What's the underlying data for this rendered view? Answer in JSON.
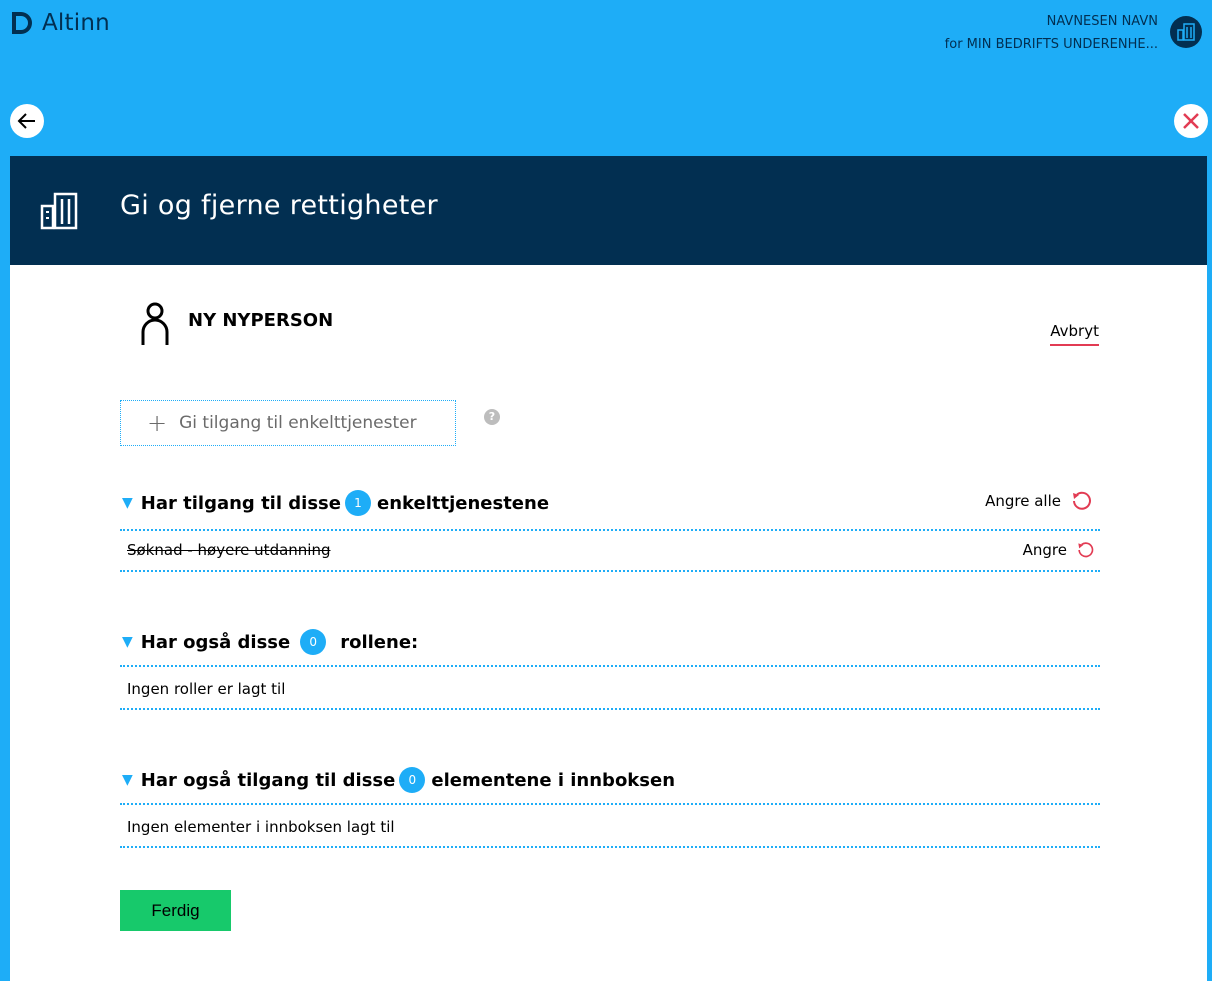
{
  "app": {
    "name": "Altinn"
  },
  "user": {
    "name": "NAVNESEN NAVN",
    "org": "for MIN BEDRIFTS UNDERENHE..."
  },
  "page": {
    "title": "Gi og fjerne rettigheter"
  },
  "person": {
    "name": "NY NYPERSON"
  },
  "actions": {
    "cancel": "Avbryt",
    "add_service": "Gi tilgang til enkelttjenester",
    "help": "?",
    "done": "Ferdig"
  },
  "sections": {
    "services": {
      "title_before": "Har tilgang til disse",
      "count": "1",
      "title_after": "enkelttjenestene",
      "undo_all": "Angre alle",
      "items": [
        {
          "label": "Søknad - høyere utdanning",
          "undo": "Angre"
        }
      ]
    },
    "roles": {
      "title_before": "Har også disse",
      "count": "0",
      "title_after": "rollene:",
      "empty": "Ingen roller er lagt til"
    },
    "inbox": {
      "title_before": "Har også tilgang til disse",
      "count": "0",
      "title_after": "elementene i innboksen",
      "empty": "Ingen elementer i innboksen lagt til"
    }
  },
  "colors": {
    "accent": "#1eadf7",
    "header": "#022f51",
    "danger": "#e23b53",
    "success": "#17c96b"
  },
  "icons": [
    "altinn-logo-icon",
    "building-icon",
    "arrow-left-icon",
    "close-icon",
    "person-icon",
    "plus-icon",
    "help-icon",
    "undo-icon",
    "triangle-down-icon"
  ]
}
